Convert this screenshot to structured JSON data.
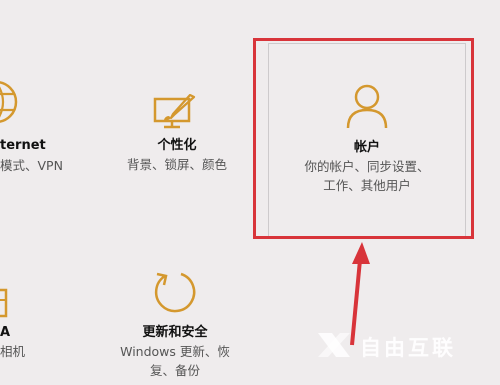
{
  "colors": {
    "background": "#efeced",
    "icon_accent": "#d4982e",
    "highlight": "#d8343a"
  },
  "tiles": {
    "network": {
      "icon": "globe-icon",
      "title": "ternet",
      "description": "模式、VPN"
    },
    "personalization": {
      "icon": "paintbrush-monitor-icon",
      "title": "个性化",
      "description": "背景、锁屏、颜色"
    },
    "accounts": {
      "icon": "person-icon",
      "title": "帐户",
      "description_line1": "你的帐户、同步设置、",
      "description_line2": "工作、其他用户"
    },
    "device": {
      "icon": "phone-icon",
      "title": "A",
      "description": "相机"
    },
    "update": {
      "icon": "refresh-icon",
      "title": "更新和安全",
      "description_line1": "Windows 更新、恢",
      "description_line2": "复、备份"
    }
  },
  "watermark": {
    "text": "自由互联"
  }
}
